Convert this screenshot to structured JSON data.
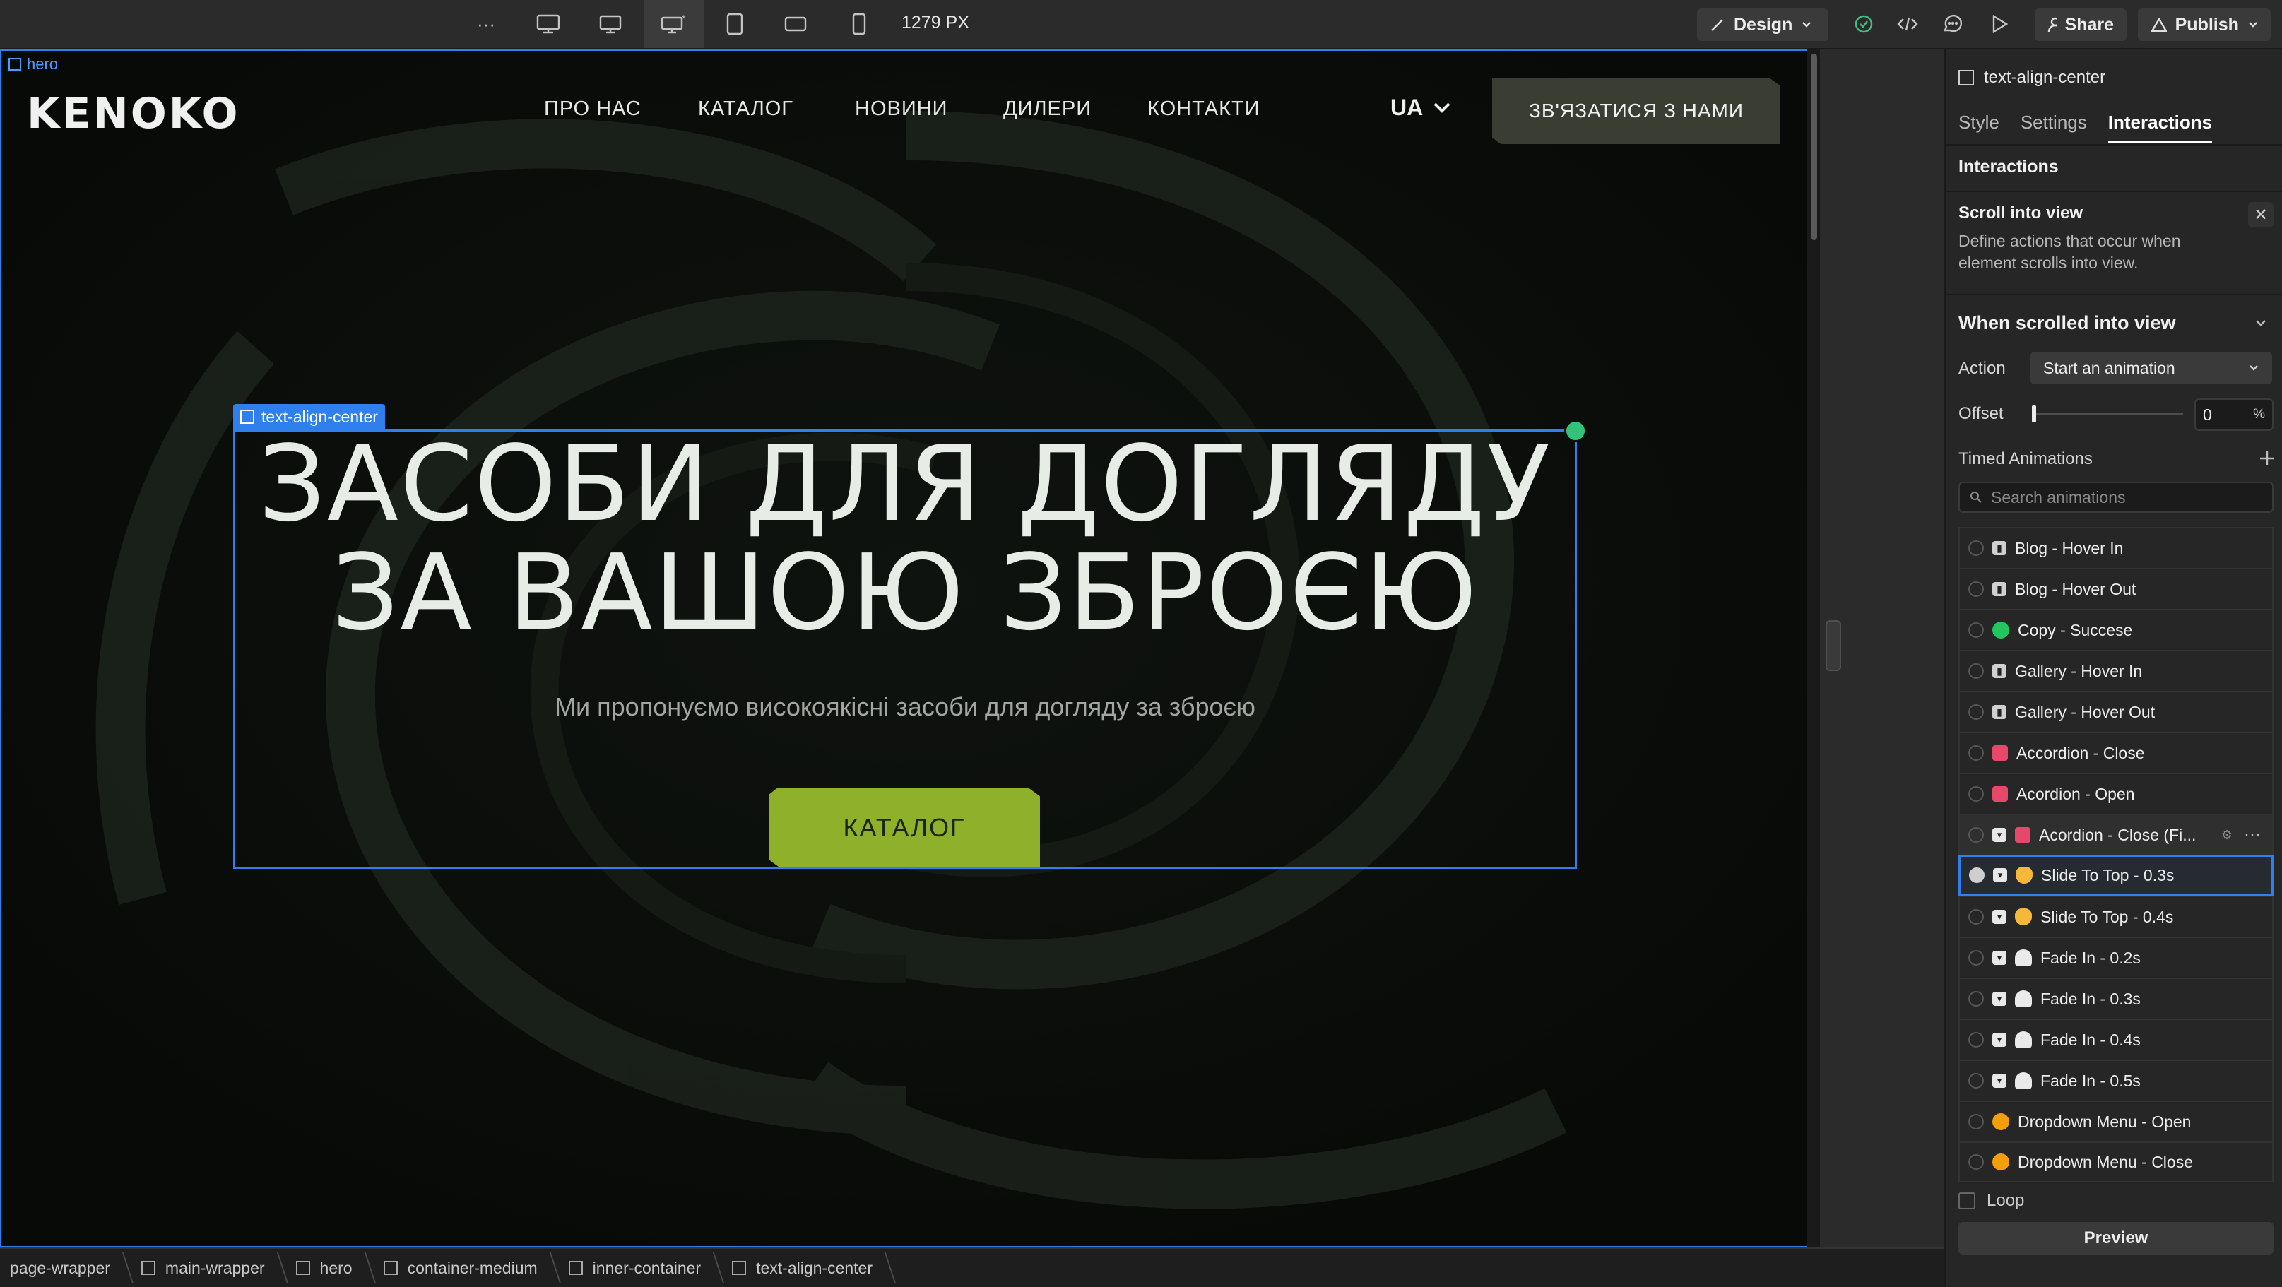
{
  "toolbar": {
    "more_icon": "more-horizontal-icon",
    "breakpoints": [
      "desktop-large-icon",
      "desktop-icon",
      "base-desktop-icon",
      "tablet-icon",
      "mobile-landscape-icon",
      "mobile-portrait-icon"
    ],
    "width_readout": "1279 PX",
    "mode_label": "Design",
    "share_label": "Share",
    "publish_label": "Publish"
  },
  "canvas": {
    "hero_tag": "hero",
    "logo": "KENOKO",
    "nav": [
      "ПРО НАС",
      "КАТАЛОГ",
      "НОВИНИ",
      "ДИЛЕРИ",
      "КОНТАКТИ"
    ],
    "lang": "UA",
    "contact_button": "ЗВ'ЯЗАТИСЯ З НАМИ",
    "selected_tag": "text-align-center",
    "headline_line1": "ЗАСОБИ ДЛЯ ДОГЛЯДУ",
    "headline_line2": "ЗА ВАШОЮ ЗБРОЄЮ",
    "subline": "Ми пропонуємо високоякісні засоби для догляду за зброєю",
    "catalog_button": "КАТАЛОГ",
    "colors": {
      "accent": "#8fb02a",
      "selection": "#2f80ed",
      "contact_bg": "#3a3d31"
    }
  },
  "panel": {
    "element_name": "text-align-center",
    "tabs": [
      "Style",
      "Settings",
      "Interactions"
    ],
    "active_tab": "Interactions",
    "section_title": "Interactions",
    "trigger_title": "Scroll into view",
    "trigger_desc": "Define actions that occur when element scrolls into view.",
    "when_title": "When scrolled into view",
    "action_label": "Action",
    "action_value": "Start an animation",
    "offset_label": "Offset",
    "offset_value": "0",
    "offset_unit": "%",
    "offset_level": 0,
    "timed_title": "Timed Animations",
    "search_placeholder": "Search animations",
    "animations": [
      {
        "name": "Blog - Hover In",
        "icon": "lock",
        "state": ""
      },
      {
        "name": "Blog - Hover Out",
        "icon": "lock",
        "state": ""
      },
      {
        "name": "Copy - Succese",
        "icon": "green",
        "state": ""
      },
      {
        "name": "Gallery - Hover In",
        "icon": "lock",
        "state": ""
      },
      {
        "name": "Gallery - Hover Out",
        "icon": "lock",
        "state": ""
      },
      {
        "name": "Accordion - Close",
        "icon": "gift",
        "state": ""
      },
      {
        "name": "Acordion - Open",
        "icon": "gift",
        "state": ""
      },
      {
        "name": "Acordion - Close (Fi...",
        "icon": "gift",
        "state": "hover",
        "component": true
      },
      {
        "name": "Slide To Top - 0.3s",
        "icon": "hand",
        "state": "selected",
        "component": true
      },
      {
        "name": "Slide To Top - 0.4s",
        "icon": "hand",
        "state": "",
        "component": true
      },
      {
        "name": "Fade In - 0.2s",
        "icon": "ghost",
        "state": "",
        "component": true
      },
      {
        "name": "Fade In - 0.3s",
        "icon": "ghost",
        "state": "",
        "component": true
      },
      {
        "name": "Fade In - 0.4s",
        "icon": "ghost",
        "state": "",
        "component": true
      },
      {
        "name": "Fade In - 0.5s",
        "icon": "ghost",
        "state": "",
        "component": true
      },
      {
        "name": "Dropdown Menu - Open",
        "icon": "face",
        "state": ""
      },
      {
        "name": "Dropdown Menu - Close",
        "icon": "face",
        "state": ""
      }
    ],
    "loop_label": "Loop",
    "preview_label": "Preview"
  },
  "breadcrumb": [
    "page-wrapper",
    "main-wrapper",
    "hero",
    "container-medium",
    "inner-container",
    "text-align-center"
  ]
}
